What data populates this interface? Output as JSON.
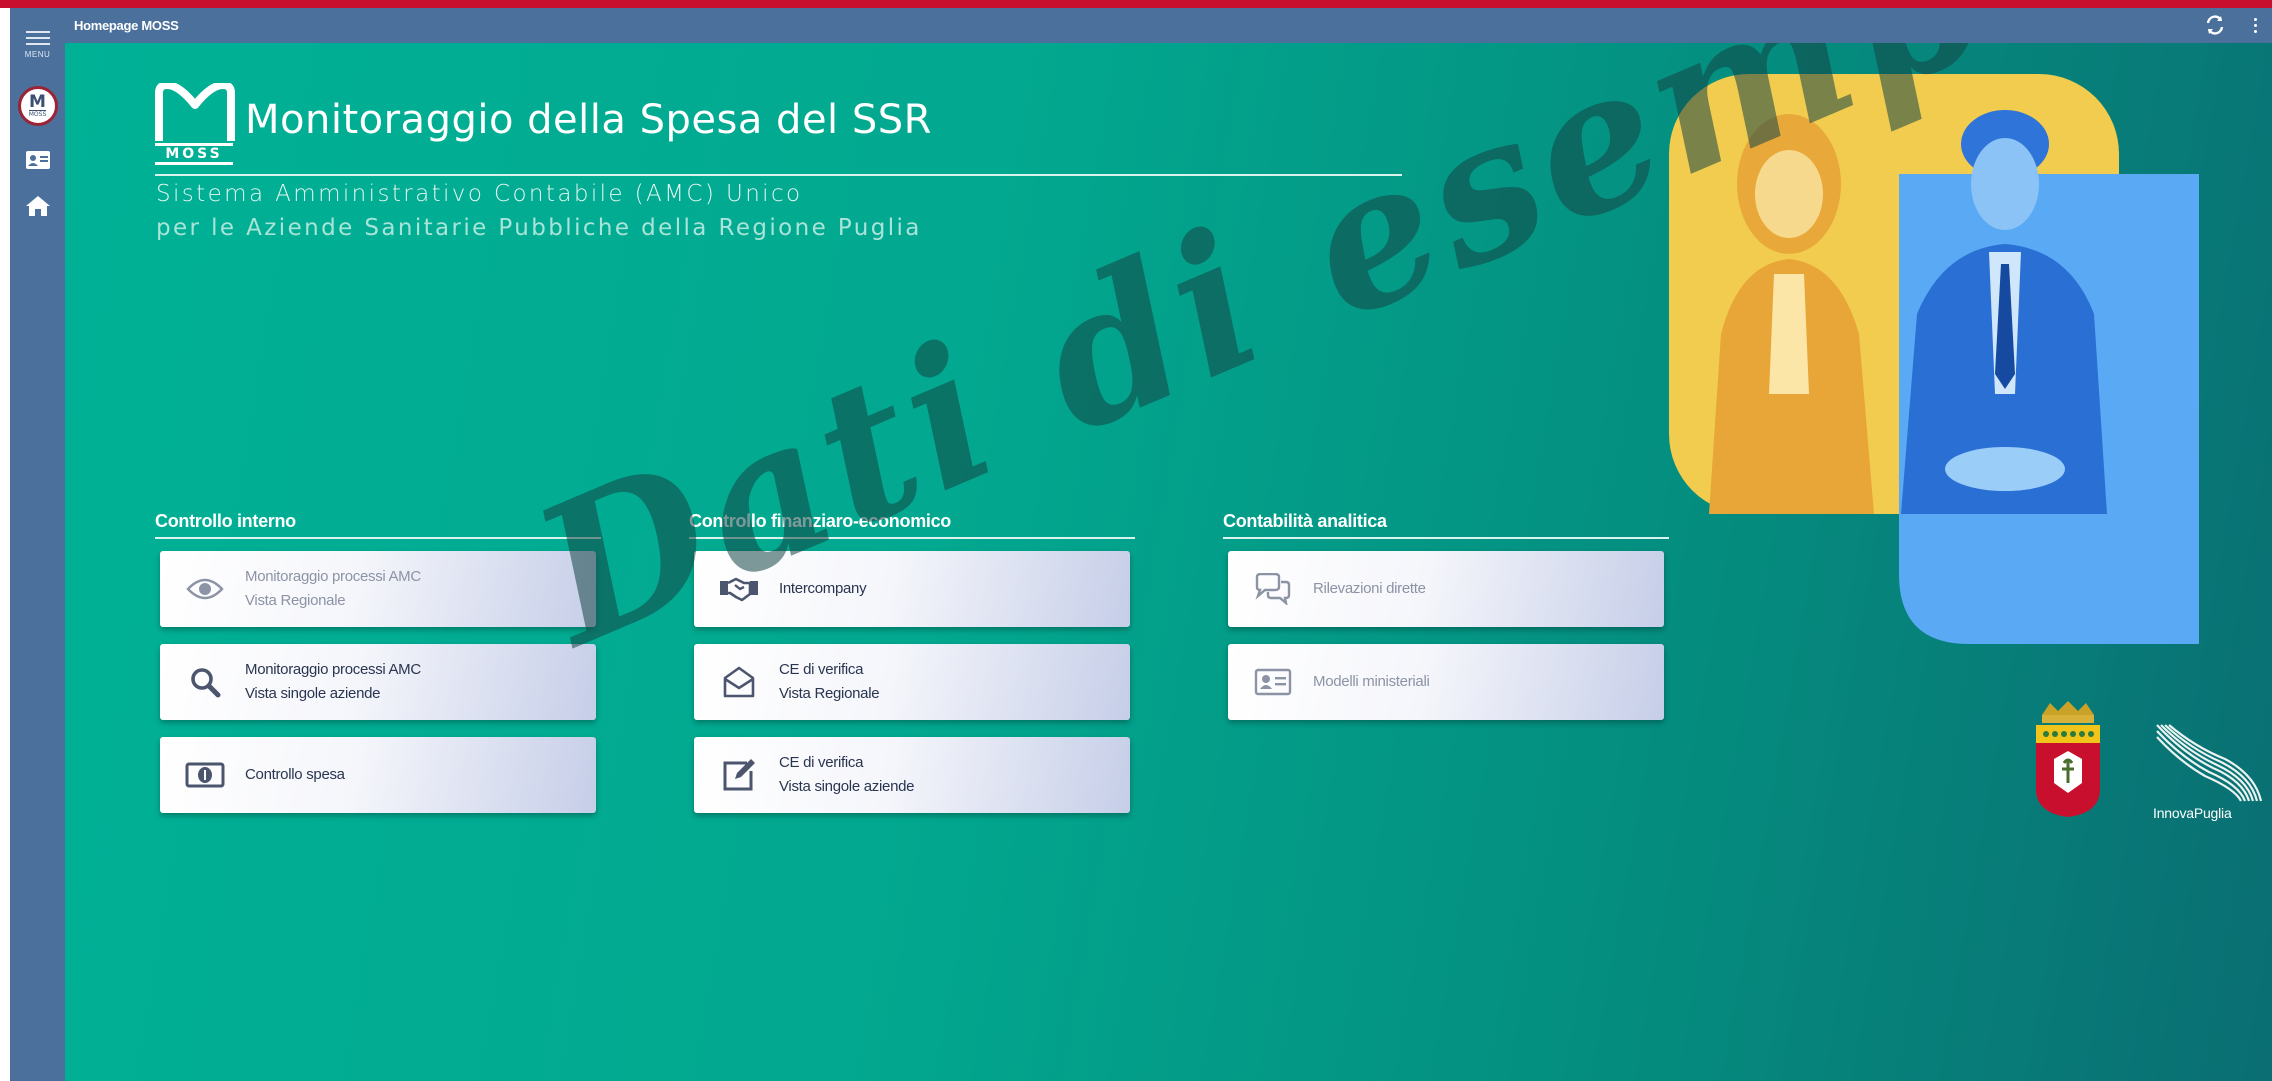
{
  "window": {
    "title": "Homepage MOSS"
  },
  "rail": {
    "menu_label": "MENU",
    "logo_letter": "M",
    "logo_word": "MOSS"
  },
  "brand": {
    "logo_word": "MOSS",
    "title": "Monitoraggio della Spesa del SSR",
    "subtitle_line1": "Sistema Amministrativo Contabile (AMC) Unico",
    "subtitle_line2": "per le Aziende Sanitarie Pubbliche della Regione Puglia"
  },
  "sections": [
    {
      "title": "Controllo interno",
      "tiles": [
        {
          "line1": "Monitoraggio processi AMC",
          "line2": "Vista Regionale",
          "icon": "eye-icon",
          "enabled": false
        },
        {
          "line1": "Monitoraggio processi AMC",
          "line2": "Vista singole aziende",
          "icon": "search-icon",
          "enabled": true
        },
        {
          "line1": "Controllo spesa",
          "line2": "",
          "icon": "money-bill-icon",
          "enabled": true
        }
      ]
    },
    {
      "title": "Controllo finanziaro-economico",
      "tiles": [
        {
          "line1": "Intercompany",
          "line2": "",
          "icon": "handshake-icon",
          "enabled": true
        },
        {
          "line1": "CE di verifica",
          "line2": "Vista Regionale",
          "icon": "envelope-open-icon",
          "enabled": true
        },
        {
          "line1": "CE di verifica",
          "line2": "Vista singole aziende",
          "icon": "edit-icon",
          "enabled": true
        }
      ]
    },
    {
      "title": "Contabilità analitica",
      "tiles": [
        {
          "line1": "Rilevazioni dirette",
          "line2": "",
          "icon": "comments-icon",
          "enabled": false
        },
        {
          "line1": "Modelli ministeriali",
          "line2": "",
          "icon": "id-card-icon",
          "enabled": false
        }
      ]
    }
  ],
  "partner_logo": {
    "text": "InnovaPuglia"
  },
  "watermark": "Dati di esempio",
  "colors": {
    "accent_bar": "#c8102e",
    "nav": "#4a709b",
    "background_start": "#00b196",
    "background_end": "#0a6e72",
    "hero_yellow": "#f2cc4f",
    "hero_blue": "#5aa9f5"
  }
}
